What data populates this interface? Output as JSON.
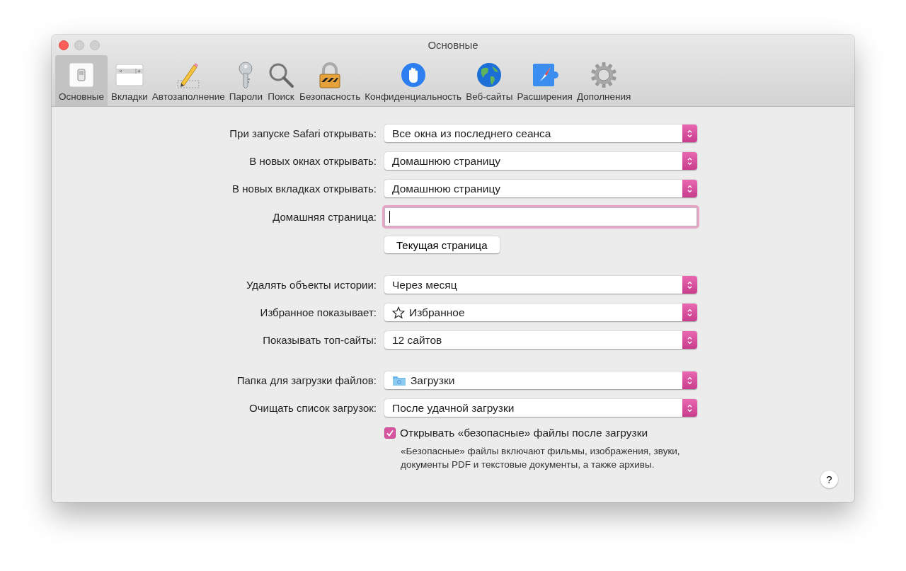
{
  "window": {
    "title": "Основные"
  },
  "toolbar": {
    "tabs": [
      {
        "label": "Основные",
        "selected": true
      },
      {
        "label": "Вкладки",
        "selected": false
      },
      {
        "label": "Автозаполнение",
        "selected": false
      },
      {
        "label": "Пароли",
        "selected": false
      },
      {
        "label": "Поиск",
        "selected": false
      },
      {
        "label": "Безопасность",
        "selected": false
      },
      {
        "label": "Конфиденциальность",
        "selected": false
      },
      {
        "label": "Веб-сайты",
        "selected": false
      },
      {
        "label": "Расширения",
        "selected": false
      },
      {
        "label": "Дополнения",
        "selected": false
      }
    ]
  },
  "groups": [
    {
      "rows": [
        {
          "kind": "popup",
          "label": "При запуске Safari открывать:",
          "value": "Все окна из последнего сеанса"
        },
        {
          "kind": "popup",
          "label": "В новых окнах открывать:",
          "value": "Домашнюю страницу"
        },
        {
          "kind": "popup",
          "label": "В новых вкладках открывать:",
          "value": "Домашнюю страницу"
        },
        {
          "kind": "field",
          "label": "Домашняя страница:",
          "focused": true
        },
        {
          "kind": "button",
          "text": "Текущая страница"
        }
      ]
    },
    {
      "rows": [
        {
          "kind": "popup",
          "label": "Удалять объекты истории:",
          "value": "Через месяц"
        },
        {
          "kind": "popup",
          "label": "Избранное показывает:",
          "value": "Избранное"
        },
        {
          "kind": "popup",
          "label": "Показывать топ-сайты:",
          "value": "12 сайтов"
        }
      ]
    },
    {
      "rows": [
        {
          "kind": "popup",
          "label": "Папка для загрузки файлов:",
          "value": "Загрузки"
        },
        {
          "kind": "popup",
          "label": "Очищать список загрузок:",
          "value": "После удачной загрузки"
        },
        {
          "kind": "checkbox",
          "text": "Открывать «безопасные» файлы после загрузки",
          "checked": true,
          "note": "«Безопасные» файлы включают фильмы, изображения, звуки, документы PDF и текстовые документы, а также архивы."
        }
      ]
    }
  ],
  "help_button": {
    "text": "?"
  }
}
